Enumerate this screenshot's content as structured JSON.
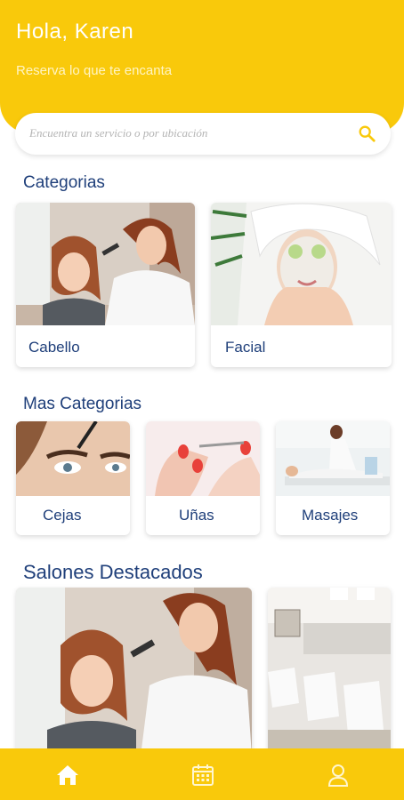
{
  "header": {
    "greeting": "Hola, Karen",
    "subtitle": "Reserva lo que te encanta"
  },
  "search": {
    "placeholder": "Encuentra un servicio o por ubicación",
    "icon": "search-icon"
  },
  "categories": {
    "title": "Categorias",
    "items": [
      {
        "label": "Cabello"
      },
      {
        "label": "Facial"
      }
    ]
  },
  "more_categories": {
    "title": "Mas Categorias",
    "items": [
      {
        "label": "Cejas"
      },
      {
        "label": "Uñas"
      },
      {
        "label": "Masajes"
      }
    ]
  },
  "featured": {
    "title": "Salones Destacados"
  },
  "bottom_nav": {
    "items": [
      "home-icon",
      "calendar-icon",
      "user-icon"
    ]
  },
  "colors": {
    "accent": "#f9c90b",
    "text": "#1f3f7a"
  }
}
